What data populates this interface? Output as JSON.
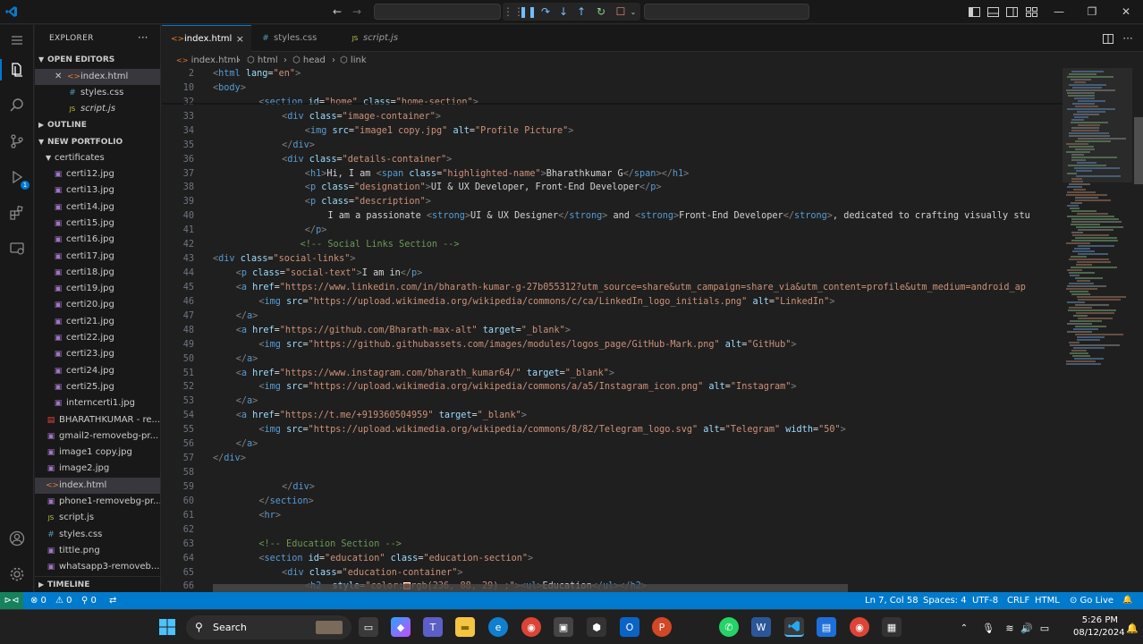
{
  "window": {
    "layout_icons": [
      "toggle-primary-sidebar-icon",
      "toggle-panel-icon",
      "toggle-secondary-sidebar-icon",
      "customize-layout-icon"
    ]
  },
  "sidebar": {
    "header": "EXPLORER",
    "more": "···",
    "open_editors_label": "OPEN EDITORS",
    "open_editors": [
      {
        "label": "index.html",
        "type": "html"
      },
      {
        "label": "styles.css",
        "type": "css"
      },
      {
        "label": "script.js",
        "type": "js"
      }
    ],
    "outline_label": "OUTLINE",
    "folder_label": "NEW PORTFOLIO",
    "subfolder_label": "certificates",
    "certificates": [
      "certi12.jpg",
      "certi13.jpg",
      "certi14.jpg",
      "certi15.jpg",
      "certi16.jpg",
      "certi17.jpg",
      "certi18.jpg",
      "certi19.jpg",
      "certi20.jpg",
      "certi21.jpg",
      "certi22.jpg",
      "certi23.jpg",
      "certi24.jpg",
      "certi25.jpg",
      "interncerti1.jpg"
    ],
    "files": [
      {
        "label": "BHARATHKUMAR - re...",
        "type": "pdf"
      },
      {
        "label": "gmail2-removebg-pr...",
        "type": "img"
      },
      {
        "label": "image1 copy.jpg",
        "type": "img"
      },
      {
        "label": "image2.jpg",
        "type": "img"
      },
      {
        "label": "index.html",
        "type": "html"
      },
      {
        "label": "phone1-removebg-pr...",
        "type": "img"
      },
      {
        "label": "script.js",
        "type": "js"
      },
      {
        "label": "styles.css",
        "type": "css"
      },
      {
        "label": "tittle.png",
        "type": "img"
      },
      {
        "label": "whatsapp3-removeb...",
        "type": "img"
      }
    ],
    "timeline_label": "TIMELINE"
  },
  "tabs": [
    {
      "label": "index.html",
      "icon": "<>",
      "active": true,
      "close": "×"
    },
    {
      "label": "styles.css",
      "icon": "#",
      "active": false
    },
    {
      "label": "script.js",
      "icon": "JS",
      "active": false
    }
  ],
  "breadcrumb": [
    "index.html",
    "html",
    "head",
    "link"
  ],
  "code_lines": [
    {
      "n": "2",
      "indent": 0,
      "html": "<span class='p'>&lt;</span><span class='t'>html</span> <span class='a'>lang</span>=<span class='s'>\"en\"</span><span class='p'>&gt;</span>"
    },
    {
      "n": "10",
      "indent": 0,
      "html": "<span class='p'>&lt;</span><span class='t'>body</span><span class='p'>&gt;</span>"
    },
    {
      "n": "32",
      "indent": 2,
      "html": "<span class='p'>&lt;</span><span class='t'>section</span> <span class='a'>id</span>=<span class='s'>\"home\"</span> <span class='a'>class</span>=<span class='s'>\"home-section\"</span><span class='p'>&gt;</span>"
    },
    {
      "n": "33",
      "indent": 3,
      "html": "<span class='p'>&lt;</span><span class='t'>div</span> <span class='a'>class</span>=<span class='s'>\"image-container\"</span><span class='p'>&gt;</span>"
    },
    {
      "n": "34",
      "indent": 4,
      "html": "<span class='p'>&lt;</span><span class='t'>img</span> <span class='a'>src</span>=<span class='s'>\"image1 copy.jpg\"</span> <span class='a'>alt</span>=<span class='s'>\"Profile Picture\"</span><span class='p'>&gt;</span>"
    },
    {
      "n": "35",
      "indent": 3,
      "html": "<span class='p'>&lt;/</span><span class='t'>div</span><span class='p'>&gt;</span>"
    },
    {
      "n": "36",
      "indent": 3,
      "html": "<span class='p'>&lt;</span><span class='t'>div</span> <span class='a'>class</span>=<span class='s'>\"details-container\"</span><span class='p'>&gt;</span>"
    },
    {
      "n": "37",
      "indent": 4,
      "html": "<span class='p'>&lt;</span><span class='t'>h1</span><span class='p'>&gt;</span>Hi, I am <span class='p'>&lt;</span><span class='t'>span</span> <span class='a'>class</span>=<span class='s'>\"highlighted-name\"</span><span class='p'>&gt;</span>Bharathkumar G<span class='p'>&lt;/</span><span class='t'>span</span><span class='p'>&gt;&lt;/</span><span class='t'>h1</span><span class='p'>&gt;</span>"
    },
    {
      "n": "38",
      "indent": 4,
      "html": "<span class='p'>&lt;</span><span class='t'>p</span> <span class='a'>class</span>=<span class='s'>\"designation\"</span><span class='p'>&gt;</span>UI &amp; UX Developer, Front-End Developer<span class='p'>&lt;/</span><span class='t'>p</span><span class='p'>&gt;</span>"
    },
    {
      "n": "39",
      "indent": 4,
      "html": "<span class='p'>&lt;</span><span class='t'>p</span> <span class='a'>class</span>=<span class='s'>\"description\"</span><span class='p'>&gt;</span>"
    },
    {
      "n": "40",
      "indent": 5,
      "html": "I am a passionate <span class='p'>&lt;</span><span class='t'>strong</span><span class='p'>&gt;</span>UI &amp; UX Designer<span class='p'>&lt;/</span><span class='t'>strong</span><span class='p'>&gt;</span> and <span class='p'>&lt;</span><span class='t'>strong</span><span class='p'>&gt;</span>Front-End Developer<span class='p'>&lt;/</span><span class='t'>strong</span><span class='p'>&gt;</span>, dedicated to crafting visually stu"
    },
    {
      "n": "41",
      "indent": 4,
      "html": "<span class='p'>&lt;/</span><span class='t'>p</span><span class='p'>&gt;</span>"
    },
    {
      "n": "42",
      "indent": 3.8,
      "html": "<span class='c'>&lt;!-- Social Links Section --&gt;</span>"
    },
    {
      "n": "43",
      "indent": 0,
      "html": "<span class='p'>&lt;</span><span class='t'>div</span> <span class='a'>class</span>=<span class='s'>\"social-links\"</span><span class='p'>&gt;</span>"
    },
    {
      "n": "44",
      "indent": 1,
      "html": "<span class='p'>&lt;</span><span class='t'>p</span> <span class='a'>class</span>=<span class='s'>\"social-text\"</span><span class='p'>&gt;</span>I am in<span class='p'>&lt;/</span><span class='t'>p</span><span class='p'>&gt;</span>"
    },
    {
      "n": "45",
      "indent": 1,
      "html": "<span class='p'>&lt;</span><span class='t'>a</span> <span class='a'>href</span>=<span class='s'>\"https://www.linkedin.com/in/bharath-kumar-g-27b055312?utm_source=share&amp;utm_campaign=share_via&amp;utm_content=profile&amp;utm_medium=android_ap</span>"
    },
    {
      "n": "46",
      "indent": 2,
      "html": "<span class='p'>&lt;</span><span class='t'>img</span> <span class='a'>src</span>=<span class='s'>\"https://upload.wikimedia.org/wikipedia/commons/c/ca/LinkedIn_logo_initials.png\"</span> <span class='a'>alt</span>=<span class='s'>\"LinkedIn\"</span><span class='p'>&gt;</span>"
    },
    {
      "n": "47",
      "indent": 1,
      "html": "<span class='p'>&lt;/</span><span class='t'>a</span><span class='p'>&gt;</span>"
    },
    {
      "n": "48",
      "indent": 1,
      "html": "<span class='p'>&lt;</span><span class='t'>a</span> <span class='a'>href</span>=<span class='s'>\"https://github.com/Bharath-max-alt\"</span> <span class='a'>target</span>=<span class='s'>\"_blank\"</span><span class='p'>&gt;</span>"
    },
    {
      "n": "49",
      "indent": 2,
      "html": "<span class='p'>&lt;</span><span class='t'>img</span> <span class='a'>src</span>=<span class='s'>\"https://github.githubassets.com/images/modules/logos_page/GitHub-Mark.png\"</span> <span class='a'>alt</span>=<span class='s'>\"GitHub\"</span><span class='p'>&gt;</span>"
    },
    {
      "n": "50",
      "indent": 1,
      "html": "<span class='p'>&lt;/</span><span class='t'>a</span><span class='p'>&gt;</span>"
    },
    {
      "n": "51",
      "indent": 1,
      "html": "<span class='p'>&lt;</span><span class='t'>a</span> <span class='a'>href</span>=<span class='s'>\"https://www.instagram.com/bharath_kumar64/\"</span> <span class='a'>target</span>=<span class='s'>\"_blank\"</span><span class='p'>&gt;</span>"
    },
    {
      "n": "52",
      "indent": 2,
      "html": "<span class='p'>&lt;</span><span class='t'>img</span> <span class='a'>src</span>=<span class='s'>\"https://upload.wikimedia.org/wikipedia/commons/a/a5/Instagram_icon.png\"</span> <span class='a'>alt</span>=<span class='s'>\"Instagram\"</span><span class='p'>&gt;</span>"
    },
    {
      "n": "53",
      "indent": 1,
      "html": "<span class='p'>&lt;/</span><span class='t'>a</span><span class='p'>&gt;</span>"
    },
    {
      "n": "54",
      "indent": 1,
      "html": "<span class='p'>&lt;</span><span class='t'>a</span> <span class='a'>href</span>=<span class='s'>\"https://t.me/+919360504959\"</span> <span class='a'>target</span>=<span class='s'>\"_blank\"</span><span class='p'>&gt;</span>"
    },
    {
      "n": "55",
      "indent": 2,
      "html": "<span class='p'>&lt;</span><span class='t'>img</span> <span class='a'>src</span>=<span class='s'>\"https://upload.wikimedia.org/wikipedia/commons/8/82/Telegram_logo.svg\"</span> <span class='a'>alt</span>=<span class='s'>\"Telegram\"</span> <span class='a'>width</span>=<span class='s'>\"50\"</span><span class='p'>&gt;</span>"
    },
    {
      "n": "56",
      "indent": 1,
      "html": "<span class='p'>&lt;/</span><span class='t'>a</span><span class='p'>&gt;</span>"
    },
    {
      "n": "57",
      "indent": 0,
      "html": "<span class='p'>&lt;/</span><span class='t'>div</span><span class='p'>&gt;</span>"
    },
    {
      "n": "58",
      "indent": 0,
      "html": ""
    },
    {
      "n": "59",
      "indent": 3,
      "html": "<span class='p'>&lt;/</span><span class='t'>div</span><span class='p'>&gt;</span>"
    },
    {
      "n": "60",
      "indent": 2,
      "html": "<span class='p'>&lt;/</span><span class='t'>section</span><span class='p'>&gt;</span>"
    },
    {
      "n": "61",
      "indent": 2,
      "html": "<span class='p'>&lt;</span><span class='t'>hr</span><span class='p'>&gt;</span>"
    },
    {
      "n": "62",
      "indent": 0,
      "html": ""
    },
    {
      "n": "63",
      "indent": 2,
      "html": "<span class='c'>&lt;!-- Education Section --&gt;</span>"
    },
    {
      "n": "64",
      "indent": 2,
      "html": "<span class='p'>&lt;</span><span class='t'>section</span> <span class='a'>id</span>=<span class='s'>\"education\"</span> <span class='a'>class</span>=<span class='s'>\"education-section\"</span><span class='p'>&gt;</span>"
    },
    {
      "n": "65",
      "indent": 3,
      "html": "<span class='p'>&lt;</span><span class='t'>div</span> <span class='a'>class</span>=<span class='s'>\"education-container\"</span><span class='p'>&gt;</span>"
    },
    {
      "n": "66",
      "indent": 4,
      "html": "<span class='p'>&lt;</span><span class='t'>h2</span>  <span class='a'>style</span>=<span class='s'>\"color:</span><span style='display:inline-block;width:8px;height:8px;background:#ec581d;border:1px solid #fff;vertical-align:middle'></span><span class='s'>rgb(236, 88, 29) ;\"</span><span class='p'>&gt;&lt;</span><span class='t'>ul</span><span class='p'>&gt;</span>Education<span class='p'>&lt;/</span><span class='t'>ul</span><span class='p'>&gt;&lt;/</span><span class='t'>h2</span><span class='p'>&gt;</span>"
    }
  ],
  "statusbar": {
    "remote": "⊳⊲",
    "errors": "⊗ 0",
    "warnings": "⚠ 0",
    "ports": "⚲ 0",
    "cursor": "Ln 7, Col 58",
    "spaces": "Spaces: 4",
    "encoding": "UTF-8",
    "eol": "CRLF",
    "language": "HTML",
    "golive": "⊙ Go Live",
    "bell": "🔔"
  },
  "taskbar": {
    "search_label": "Search",
    "time": "5:26 PM",
    "date": "08/12/2024"
  },
  "colors": {
    "accent": "#007acc",
    "editor_bg": "#1f1f1f",
    "sidebar_bg": "#181818"
  }
}
